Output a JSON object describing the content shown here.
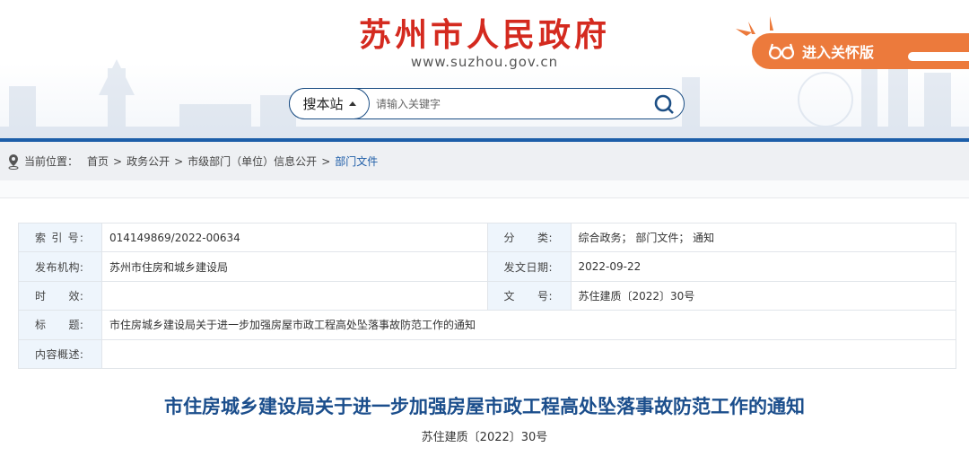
{
  "header": {
    "site_title": "苏州市人民政府",
    "site_url": "www.suzhou.gov.cn",
    "care_button": "进入关怀版",
    "search": {
      "scope": "搜本站",
      "placeholder": "请输入关键字",
      "value": ""
    }
  },
  "breadcrumb": {
    "label": "当前位置：",
    "items": [
      "首页",
      "政务公开",
      "市级部门（单位）信息公开",
      "部门文件"
    ],
    "separator": ">"
  },
  "meta": {
    "index_label": "索 引 号:",
    "index_value": "014149869/2022-00634",
    "category_label": "分　　类:",
    "category_value": "综合政务； 部门文件； 通知",
    "publisher_label": "发布机构:",
    "publisher_value": "苏州市住房和城乡建设局",
    "date_label": "发文日期:",
    "date_value": "2022-09-22",
    "validity_label": "时　　效:",
    "validity_value": "",
    "docno_label": "文　　号:",
    "docno_value": "苏住建质〔2022〕30号",
    "title_label": "标　　题:",
    "title_value": "市住房城乡建设局关于进一步加强房屋市政工程高处坠落事故防范工作的通知",
    "summary_label": "内容概述:",
    "summary_value": ""
  },
  "article": {
    "title": "市住房城乡建设局关于进一步加强房屋市政工程高处坠落事故防范工作的通知",
    "doc_number": "苏住建质〔2022〕30号"
  },
  "colors": {
    "brand_red": "#d42a1f",
    "brand_blue": "#1c5ea9",
    "care_orange": "#ec7a3c"
  }
}
